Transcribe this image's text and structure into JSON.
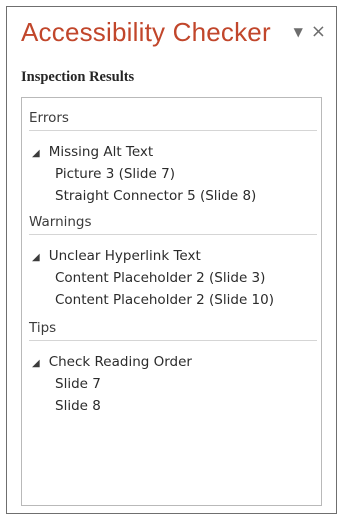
{
  "pane": {
    "title": "Accessibility Checker",
    "subtitle": "Inspection Results",
    "controls": {
      "dropdown_glyph": "▼",
      "close_glyph": "×"
    }
  },
  "results": {
    "errors": {
      "label": "Errors",
      "group": "Missing Alt Text",
      "items": [
        "Picture 3  (Slide 7)",
        "Straight Connector 5  (Slide 8)"
      ]
    },
    "warnings": {
      "label": "Warnings",
      "group": "Unclear Hyperlink Text",
      "items": [
        "Content Placeholder 2  (Slide 3)",
        "Content Placeholder 2  (Slide 10)"
      ]
    },
    "tips": {
      "label": "Tips",
      "group": "Check Reading Order",
      "items": [
        "Slide 7",
        "Slide 8"
      ]
    }
  },
  "colors": {
    "title": "#c1462b",
    "text": "#2b2b2b",
    "pane_border": "#6f6f6f",
    "divider": "#d5d5d5"
  },
  "icons": {
    "expand": "collapse-triangle-icon",
    "menu": "dropdown-caret-icon",
    "close": "close-icon"
  }
}
